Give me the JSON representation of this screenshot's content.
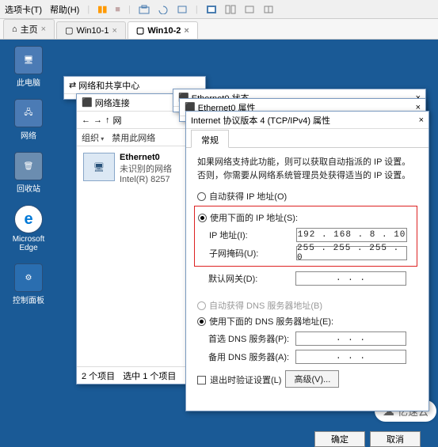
{
  "topbar": {
    "options_label": "选项卡(T)",
    "help_label": "帮助(H)"
  },
  "tabs": {
    "home": "主页",
    "t1": "Win10-1",
    "t2": "Win10-2",
    "close": "×"
  },
  "desktop": {
    "pc": "此电脑",
    "network": "网络",
    "recycle": "回收站",
    "edge": "Microsoft Edge",
    "control": "控制面板"
  },
  "win_network_center": {
    "title": "网络和共享中心"
  },
  "win_connections": {
    "title": "网络连接",
    "addr": "网",
    "organize": "组织",
    "disable": "禁用此网络",
    "adapter_name": "Ethernet0",
    "adapter_status": "未识别的网络",
    "adapter_device": "Intel(R) 8257",
    "status_count": "2 个项目",
    "status_selected": "选中 1 个项目"
  },
  "win_eth_status": {
    "title": "Ethernet0 状态",
    "close": "×"
  },
  "win_eth_props": {
    "title": "Ethernet0 属性",
    "close": "×"
  },
  "ipv4": {
    "title": "Internet 协议版本 4 (TCP/IPv4) 属性",
    "close": "×",
    "tab_general": "常规",
    "desc": "如果网络支持此功能，则可以获取自动指派的 IP 设置。否则，你需要从网络系统管理员处获得适当的 IP 设置。",
    "radio_auto_ip": "自动获得 IP 地址(O)",
    "radio_manual_ip": "使用下面的 IP 地址(S):",
    "lbl_ip": "IP 地址(I):",
    "lbl_mask": "子网掩码(U):",
    "lbl_gateway": "默认网关(D):",
    "val_ip": "192 . 168 .  8  . 10",
    "val_mask": "255 . 255 . 255 .  0",
    "val_gateway": ".       .       .",
    "radio_auto_dns": "自动获得 DNS 服务器地址(B)",
    "radio_manual_dns": "使用下面的 DNS 服务器地址(E):",
    "lbl_dns1": "首选 DNS 服务器(P):",
    "lbl_dns2": "备用 DNS 服务器(A):",
    "val_dns1": ".       .       .",
    "val_dns2": ".       .       .",
    "chk_validate": "退出时验证设置(L)",
    "btn_advanced": "高级(V)...",
    "btn_ok": "确定",
    "btn_cancel": "取消"
  },
  "watermark": "亿速云"
}
